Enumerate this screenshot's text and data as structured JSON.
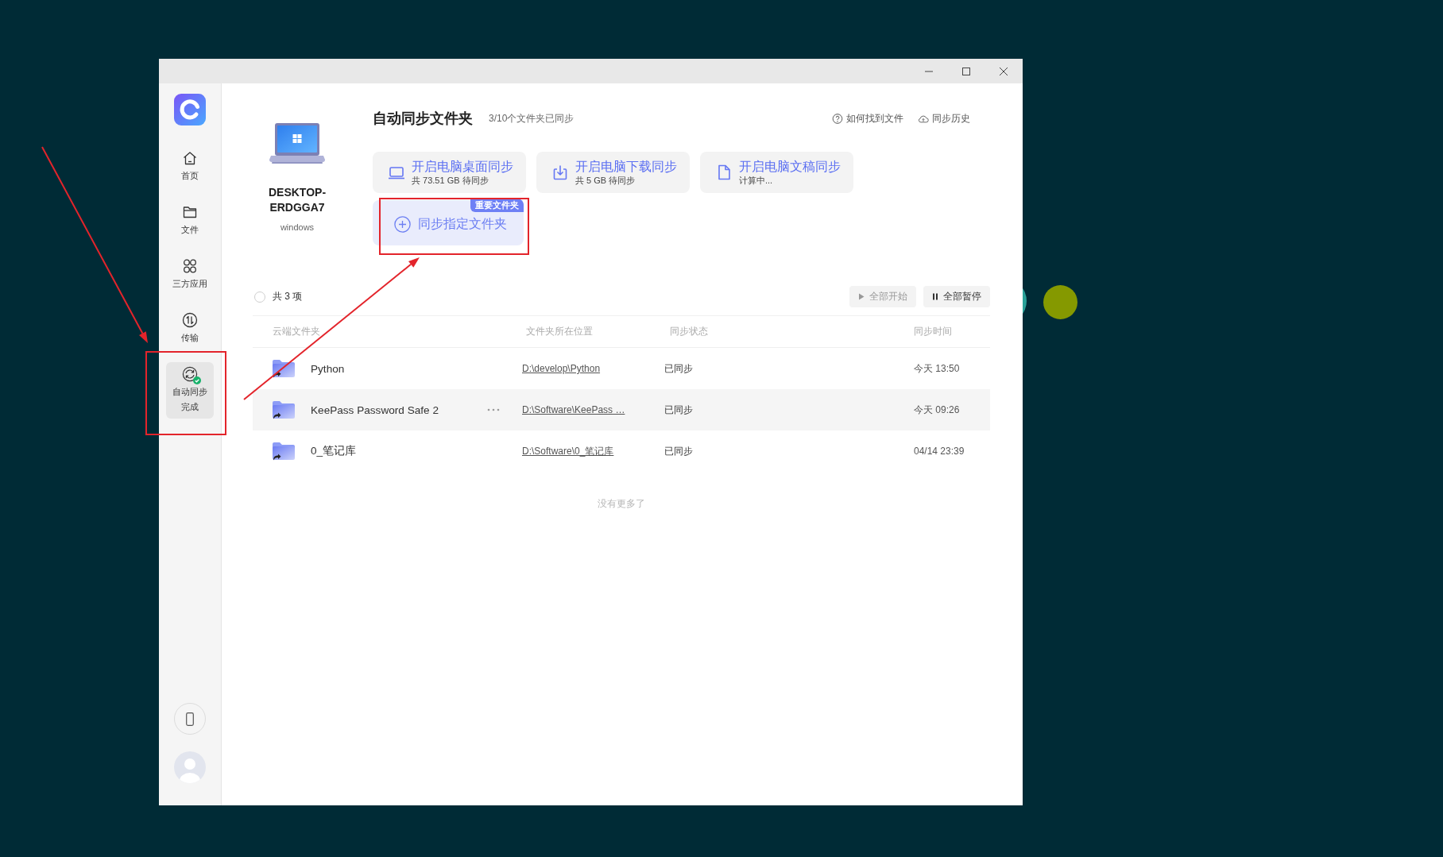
{
  "sidebar": {
    "items": [
      {
        "label": "首页",
        "selected": false,
        "done": false
      },
      {
        "label": "文件",
        "selected": false,
        "done": false
      },
      {
        "label": "三方应用",
        "selected": false,
        "done": false
      },
      {
        "label": "传输",
        "selected": false,
        "done": false
      },
      {
        "label": "自动同步完成",
        "selected": true,
        "done": true
      }
    ]
  },
  "device": {
    "name": "DESKTOP-ERDGGA7",
    "os": "windows"
  },
  "header": {
    "title": "自动同步文件夹",
    "summary": "3/10个文件夹已同步",
    "links": [
      "如何找到文件",
      "同步历史"
    ]
  },
  "quick_sync": [
    {
      "title": "开启电脑桌面同步",
      "detail": "共 73.51 GB 待同步"
    },
    {
      "title": "开启电脑下载同步",
      "detail": "共 5 GB 待同步"
    },
    {
      "title": "开启电脑文稿同步",
      "detail": "计算中..."
    }
  ],
  "custom_sync": {
    "label": "同步指定文件夹",
    "badge": "重要文件夹"
  },
  "toolbar": {
    "select_all_checked": false,
    "count": "共 3 项",
    "buttons": [
      {
        "label": "全部开始",
        "disabled": true
      },
      {
        "label": "全部暂停",
        "disabled": false
      }
    ]
  },
  "table": {
    "columns": [
      "云端文件夹",
      "文件夹所在位置",
      "同步状态",
      "同步时间"
    ],
    "rows": [
      {
        "name": "Python",
        "path": "D:\\develop\\Python",
        "status": "已同步",
        "time": "今天 13:50",
        "hovered": false
      },
      {
        "name": "KeePass Password Safe 2",
        "path": "D:\\Software\\KeePass …",
        "status": "已同步",
        "time": "今天 09:26",
        "hovered": true
      },
      {
        "name": "0_笔记库",
        "path": "D:\\Software\\0_笔记库",
        "status": "已同步",
        "time": "04/14 23:39",
        "hovered": false
      }
    ]
  },
  "footer_note": "没有更多了",
  "desktop_dots": [
    {
      "color": "#2aa198"
    },
    {
      "color": "#859900"
    }
  ]
}
